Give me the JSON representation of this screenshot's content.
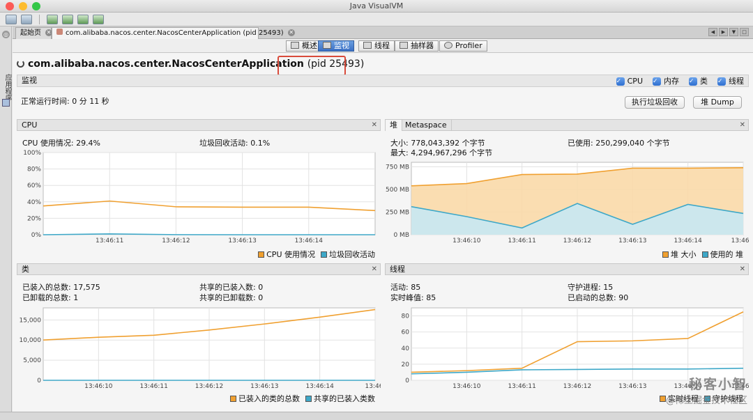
{
  "window": {
    "title": "Java VisualVM"
  },
  "sidebar": {
    "label": "应用程序"
  },
  "tabs": [
    {
      "label": "起始页"
    },
    {
      "label": "com.alibaba.nacos.center.NacosCenterApplication (pid 25493)"
    }
  ],
  "view_tabs": [
    {
      "label": "概述"
    },
    {
      "label": "监视"
    },
    {
      "label": "线程"
    },
    {
      "label": "抽样器"
    },
    {
      "label": "Profiler"
    }
  ],
  "app": {
    "name": "com.alibaba.nacos.center.NacosCenterApplication",
    "pid": "(pid 25493)"
  },
  "monitor": {
    "title": "监视",
    "checkboxes": [
      "CPU",
      "内存",
      "类",
      "线程"
    ],
    "uptime": "正常运行时间: 0 分 11 秒",
    "gc_button": "执行垃圾回收",
    "heap_dump_button": "堆 Dump"
  },
  "cpu": {
    "title": "CPU",
    "usage": "CPU 使用情况: 29.4%",
    "gc": "垃圾回收活动: 0.1%",
    "legend": [
      "CPU 使用情况",
      "垃圾回收活动"
    ],
    "colors": {
      "cpu": "#f0a030",
      "gc": "#3ea8c8"
    }
  },
  "heap": {
    "tabs": [
      "堆",
      "Metaspace"
    ],
    "size": "大小: 778,043,392 个字节",
    "max": "最大: 4,294,967,296 个字节",
    "used": "已使用: 250,299,040 个字节",
    "legend": [
      "堆 大小",
      "使用的 堆"
    ]
  },
  "classes": {
    "title": "类",
    "loaded": "已装入的总数: 17,575",
    "unloaded": "已卸载的总数: 1",
    "shared_loaded": "共享的已装入数: 0",
    "shared_unloaded": "共享的已卸载数: 0",
    "legend": [
      "已装入的类的总数",
      "共享的已装入类数"
    ]
  },
  "threads": {
    "title": "线程",
    "live": "活动: 85",
    "peak": "实时峰值: 85",
    "daemon": "守护进程: 15",
    "started": "已启动的总数: 90",
    "legend": [
      "实时线程",
      "守护线程"
    ]
  },
  "watermark": {
    "line1": "秘客小智",
    "line2": "@稀土掘金技术社区"
  },
  "chart_data": [
    {
      "type": "line",
      "title": "CPU",
      "categories": [
        "13:46:11",
        "13:46:12",
        "13:46:13",
        "13:46:14"
      ],
      "yticks": [
        "0%",
        "20%",
        "40%",
        "60%",
        "80%",
        "100%"
      ],
      "ylim": [
        0,
        100
      ],
      "x": [
        0,
        1,
        2,
        3,
        4,
        5
      ],
      "series": [
        {
          "name": "CPU 使用情况",
          "values": [
            35,
            41,
            34,
            33.5,
            33.5,
            29.4
          ]
        },
        {
          "name": "垃圾回收活动",
          "values": [
            0,
            1,
            0.1,
            0,
            0,
            0
          ]
        }
      ]
    },
    {
      "type": "area",
      "title": "堆",
      "categories": [
        "13:46:10",
        "13:46:11",
        "13:46:12",
        "13:46:13",
        "13:46:14",
        "13:46:1"
      ],
      "yticks": [
        "0 MB",
        "250 MB",
        "500 MB",
        "750 MB"
      ],
      "ylim": [
        0,
        800
      ],
      "x": [
        0,
        1,
        2,
        3,
        4,
        5,
        6
      ],
      "series": [
        {
          "name": "堆 大小",
          "values": [
            540,
            565,
            665,
            670,
            735,
            735,
            740
          ]
        },
        {
          "name": "使用的 堆",
          "values": [
            310,
            200,
            75,
            345,
            115,
            335,
            235
          ]
        }
      ]
    },
    {
      "type": "line",
      "title": "类",
      "categories": [
        "13:46:10",
        "13:46:11",
        "13:46:12",
        "13:46:13",
        "13:46:14",
        "13:46:"
      ],
      "yticks": [
        "0",
        "5,000",
        "10,000",
        "15,000"
      ],
      "ylim": [
        0,
        18000
      ],
      "x": [
        0,
        1,
        2,
        3,
        4,
        5,
        6
      ],
      "series": [
        {
          "name": "已装入的类的总数",
          "values": [
            10000,
            10700,
            11200,
            12500,
            14000,
            15700,
            17575
          ]
        },
        {
          "name": "共享的已装入类数",
          "values": [
            0,
            0,
            0,
            0,
            0,
            0,
            0
          ]
        }
      ]
    },
    {
      "type": "line",
      "title": "线程",
      "categories": [
        "13:46:10",
        "13:46:11",
        "13:46:12",
        "13:46:13",
        "13:46:14",
        "13:46:1"
      ],
      "yticks": [
        "0",
        "20",
        "40",
        "60",
        "80"
      ],
      "ylim": [
        0,
        90
      ],
      "x": [
        0,
        1,
        2,
        3,
        4,
        5,
        6
      ],
      "series": [
        {
          "name": "实时线程",
          "values": [
            10,
            12,
            15,
            48,
            49,
            52,
            85
          ]
        },
        {
          "name": "守护线程",
          "values": [
            8,
            10,
            13,
            13.5,
            14,
            14,
            15
          ]
        }
      ]
    }
  ]
}
